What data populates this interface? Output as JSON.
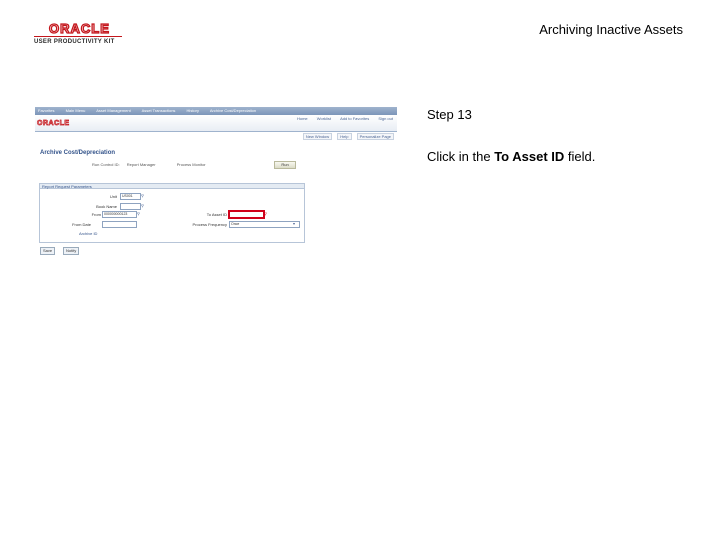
{
  "logo": {
    "company": "ORACLE",
    "product": "USER PRODUCTIVITY KIT"
  },
  "document": {
    "title": "Archiving Inactive Assets"
  },
  "thumbnail": {
    "topbar_crumbs": [
      "Favorites",
      "Main Menu",
      "Asset Management",
      "Asset Transactions",
      "History",
      "Archive Cost/Depreciation"
    ],
    "brand": "ORACLE",
    "nav_links": [
      "Home",
      "Worklist",
      "Add to Favorites",
      "Sign out"
    ],
    "subbar_links": [
      "New Window",
      "Help",
      "Personalize Page"
    ],
    "page_title": "Archive Cost/Depreciation",
    "id_labels": [
      "Run Control ID:",
      "Report Manager",
      "Process Monitor"
    ],
    "run_button": "Run",
    "section_title": "Report Request Parameters",
    "fields": {
      "unit_label": "Unit",
      "unit_value": "US001",
      "book_label": "Book Name",
      "from_asset_label": "From Asset ID",
      "from_asset_value": "000000000123",
      "from_date_label": "From Date",
      "to_asset_label": "To Asset ID",
      "process_frequency_label": "Process Frequency",
      "process_frequency_value": "Once",
      "archive_label": "Archive ID"
    },
    "buttons": [
      "Save",
      "Notify"
    ]
  },
  "step": {
    "title": "Step 13",
    "instruction_prefix": "Click in the ",
    "instruction_bold": "To Asset ID",
    "instruction_suffix": " field."
  }
}
